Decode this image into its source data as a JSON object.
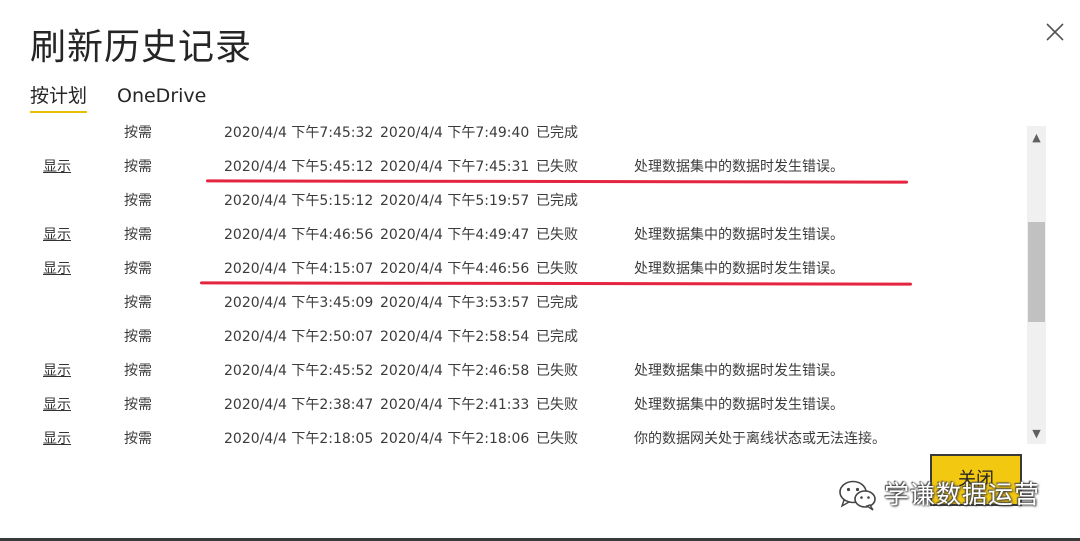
{
  "dialog": {
    "title": "刷新历史记录",
    "close_label": "关闭"
  },
  "tabs": [
    {
      "label": "按计划",
      "active": true
    },
    {
      "label": "OneDrive",
      "active": false
    }
  ],
  "rows": [
    {
      "link": "",
      "type": "按需",
      "start": "2020/4/4 下午7:45:32",
      "end": "2020/4/4 下午7:49:40",
      "status": "已完成",
      "detail": ""
    },
    {
      "link": "显示",
      "type": "按需",
      "start": "2020/4/4 下午5:45:12",
      "end": "2020/4/4 下午7:45:31",
      "status": "已失败",
      "detail": "处理数据集中的数据时发生错误。"
    },
    {
      "link": "",
      "type": "按需",
      "start": "2020/4/4 下午5:15:12",
      "end": "2020/4/4 下午5:19:57",
      "status": "已完成",
      "detail": ""
    },
    {
      "link": "显示",
      "type": "按需",
      "start": "2020/4/4 下午4:46:56",
      "end": "2020/4/4 下午4:49:47",
      "status": "已失败",
      "detail": "处理数据集中的数据时发生错误。"
    },
    {
      "link": "显示",
      "type": "按需",
      "start": "2020/4/4 下午4:15:07",
      "end": "2020/4/4 下午4:46:56",
      "status": "已失败",
      "detail": "处理数据集中的数据时发生错误。"
    },
    {
      "link": "",
      "type": "按需",
      "start": "2020/4/4 下午3:45:09",
      "end": "2020/4/4 下午3:53:57",
      "status": "已完成",
      "detail": ""
    },
    {
      "link": "",
      "type": "按需",
      "start": "2020/4/4 下午2:50:07",
      "end": "2020/4/4 下午2:58:54",
      "status": "已完成",
      "detail": ""
    },
    {
      "link": "显示",
      "type": "按需",
      "start": "2020/4/4 下午2:45:52",
      "end": "2020/4/4 下午2:46:58",
      "status": "已失败",
      "detail": "处理数据集中的数据时发生错误。"
    },
    {
      "link": "显示",
      "type": "按需",
      "start": "2020/4/4 下午2:38:47",
      "end": "2020/4/4 下午2:41:33",
      "status": "已失败",
      "detail": "处理数据集中的数据时发生错误。"
    },
    {
      "link": "显示",
      "type": "按需",
      "start": "2020/4/4 下午2:18:05",
      "end": "2020/4/4 下午2:18:06",
      "status": "已失败",
      "detail": "你的数据网关处于离线状态或无法连接。"
    }
  ],
  "watermark": {
    "text": "学谦数据运营"
  },
  "colors": {
    "accent": "#f2c811",
    "annotation": "#e5253f",
    "scrollbar_thumb": "#c1c1c1"
  }
}
